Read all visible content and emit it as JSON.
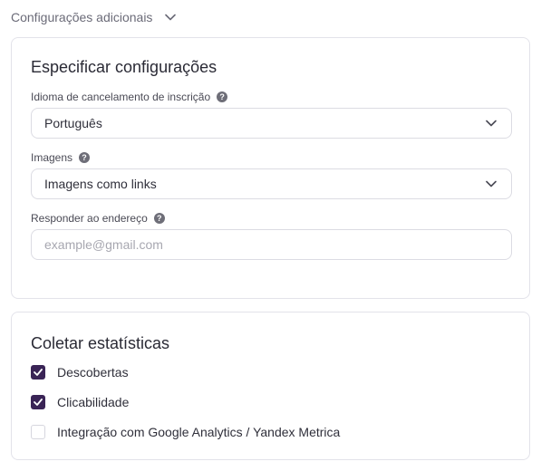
{
  "section_toggle": {
    "label": "Configurações adicionais",
    "icon": "chevron-down-icon",
    "expanded": true
  },
  "settings": {
    "title": "Especificar configurações",
    "unsubscribe_language": {
      "label": "Idioma de cancelamento de inscrição",
      "value": "Português"
    },
    "images": {
      "label": "Imagens",
      "value": "Imagens como links"
    },
    "reply_to": {
      "label": "Responder ao endereço",
      "value": "",
      "placeholder": "example@gmail.com"
    }
  },
  "stats": {
    "title": "Coletar estatísticas",
    "options": [
      {
        "label": "Descobertas",
        "checked": true
      },
      {
        "label": "Clicabilidade",
        "checked": true
      },
      {
        "label": "Integração com Google Analytics / Yandex Metrica",
        "checked": false
      }
    ]
  },
  "colors": {
    "checkbox_checked": "#3a2456",
    "border": "#e3e3ea",
    "help_icon": "#6e6e78"
  }
}
